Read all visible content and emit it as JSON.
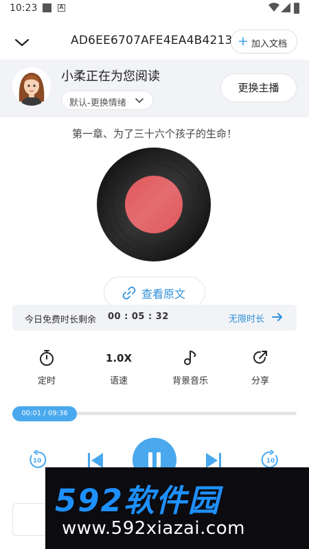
{
  "status_bar": {
    "time": "10:23"
  },
  "header": {
    "doc_title": "AD6EE6707AFE4EA4B4213",
    "add_doc_label": "加入文档"
  },
  "reader": {
    "name_text": "小柔正在为您阅读",
    "emotion_label": "默认-更换情绪",
    "change_anchor_label": "更换主播"
  },
  "chapter_title": "第一章、为了三十六个孩子的生命！",
  "view_source_label": "查看原文",
  "free_time": {
    "label": "今日免费时长剩余",
    "remaining": "00 : 05 : 32",
    "unlimited_label": "无限时长"
  },
  "tools": {
    "timer_label": "定时",
    "speed_value": "1.0X",
    "speed_label": "语速",
    "music_label": "背景音乐",
    "share_label": "分享"
  },
  "progress": {
    "time_text": "00:01 / 09:36",
    "fraction": 0.0017
  },
  "controls": {
    "rewind_seconds": "10",
    "forward_seconds": "10"
  },
  "watermark": {
    "brand": "592软件园",
    "url": "www.592xiazai.com"
  },
  "colors": {
    "accent": "#4aa9ee",
    "link": "#2f8fd8",
    "disc_label": "#e0585c",
    "card_bg": "#f2f3f7"
  }
}
